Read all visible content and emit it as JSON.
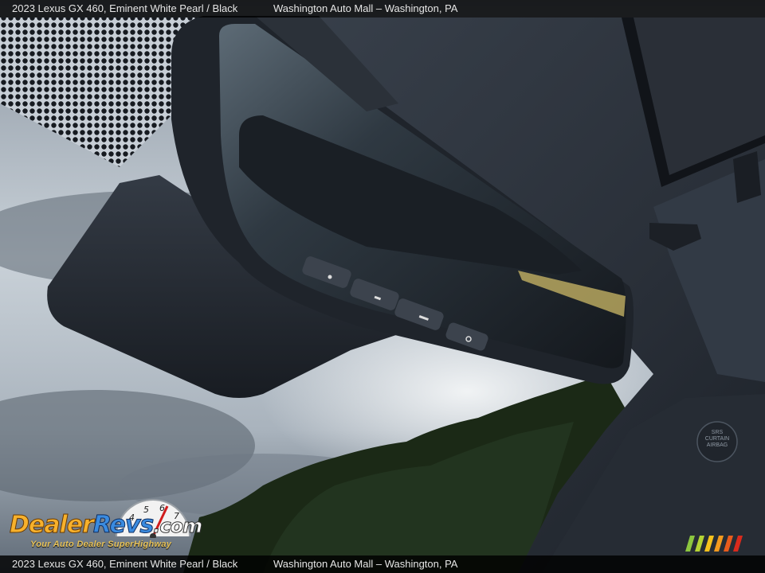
{
  "caption": {
    "vehicle": "2023 Lexus GX 460,  Eminent White Pearl / Black",
    "dealer": "Washington Auto Mall – Washington, PA"
  },
  "watermark": {
    "brand_part1": "Dealer",
    "brand_part2": "Revs",
    "brand_part3": ".com",
    "tagline": "Your Auto Dealer SuperHighway",
    "gauge_digits": [
      "4",
      "5",
      "6",
      "7"
    ]
  },
  "scene": {
    "airbag_label_line1": "SRS",
    "airbag_label_line2": "CURTAIN",
    "airbag_label_line3": "AIRBAG"
  },
  "colors": {
    "headliner": "#2b313a",
    "mirror_housing": "#22272e",
    "sky": "#9aa6b2",
    "trees": "#1c2a17",
    "stripe_colors": [
      "#8cc63f",
      "#b5d334",
      "#f6c21c",
      "#f39a1e",
      "#e85b1c",
      "#d92a1c"
    ]
  }
}
